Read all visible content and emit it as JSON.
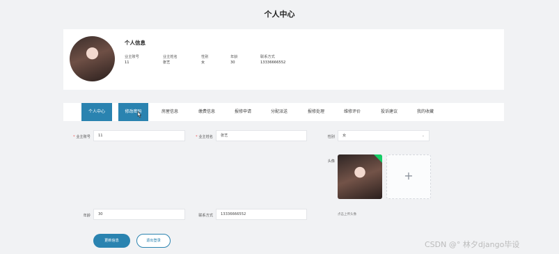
{
  "page": {
    "title": "个人中心"
  },
  "profile": {
    "section_title": "个人信息",
    "fields": [
      {
        "label": "业主账号",
        "value": "11"
      },
      {
        "label": "业主姓名",
        "value": "张艺"
      },
      {
        "label": "性别",
        "value": "女"
      },
      {
        "label": "年龄",
        "value": "30"
      },
      {
        "label": "联系方式",
        "value": "13336666552"
      }
    ]
  },
  "tabs": [
    {
      "label": "个人中心",
      "active": true
    },
    {
      "label": "修改密码",
      "active": true
    },
    {
      "label": "房屋信息",
      "active": false
    },
    {
      "label": "缴费信息",
      "active": false
    },
    {
      "label": "报修申请",
      "active": false
    },
    {
      "label": "分配派送",
      "active": false
    },
    {
      "label": "报修处理",
      "active": false
    },
    {
      "label": "维修评价",
      "active": false
    },
    {
      "label": "投诉建议",
      "active": false
    },
    {
      "label": "我的收藏",
      "active": false
    }
  ],
  "form": {
    "account": {
      "label": "业主账号",
      "required_mark": "*",
      "value": "11"
    },
    "name": {
      "label": "业主姓名",
      "required_mark": "*",
      "value": "张艺"
    },
    "gender": {
      "label": "性别",
      "value": "女"
    },
    "avatar": {
      "label": "头像",
      "hint": "点击上传头像",
      "add_symbol": "+"
    },
    "age": {
      "label": "年龄",
      "value": "30"
    },
    "phone": {
      "label": "联系方式",
      "value": "13336666552"
    }
  },
  "buttons": {
    "update": "更新信息",
    "logout": "退出登录"
  },
  "watermark": "CSDN @°  林夕django毕设",
  "colors": {
    "primary": "#2a83b0",
    "background": "#f1f2f4",
    "success": "#13ce66"
  }
}
